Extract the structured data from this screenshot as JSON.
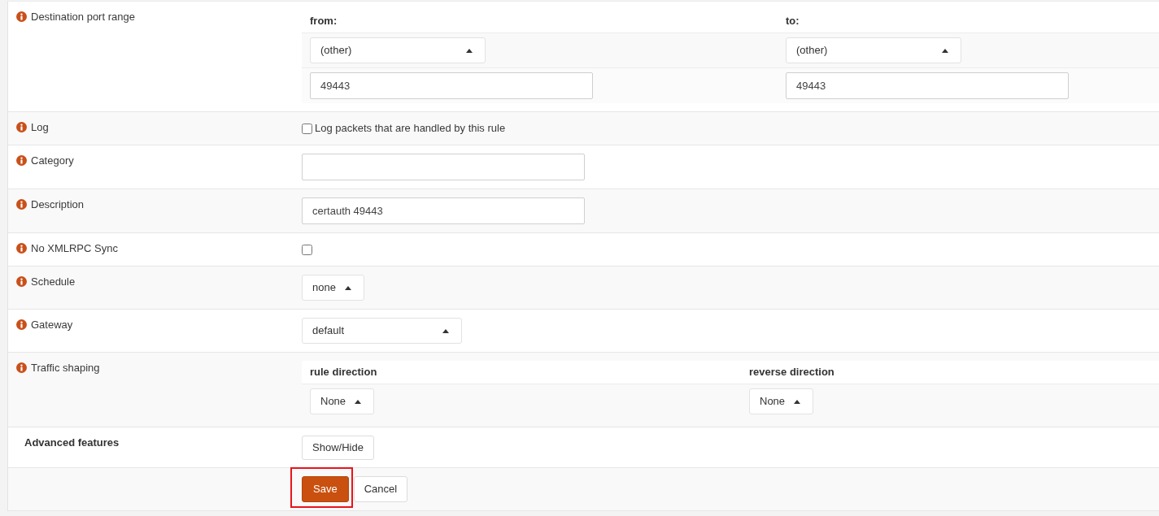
{
  "rows": [
    {
      "kind": "range",
      "label": "Destination port range",
      "info": true,
      "columns": [
        {
          "heading": "from:",
          "select": "(other)",
          "value": "49443"
        },
        {
          "heading": "to:",
          "select": "(other)",
          "value": "49443"
        }
      ]
    },
    {
      "kind": "checkbox",
      "label": "Log",
      "info": true,
      "checked": false,
      "text": "Log packets that are handled by this rule"
    },
    {
      "kind": "input",
      "label": "Category",
      "info": true
    },
    {
      "kind": "input",
      "label": "Description",
      "info": true,
      "value": "certauth 49443"
    },
    {
      "kind": "checkbox",
      "label": "No XMLRPC Sync",
      "info": true,
      "checked": false
    },
    {
      "kind": "picker",
      "label": "Schedule",
      "info": true,
      "select": "none"
    },
    {
      "kind": "select",
      "label": "Gateway",
      "info": true,
      "select": "default"
    },
    {
      "kind": "shaping",
      "label": "Traffic shaping",
      "info": true,
      "columns": [
        {
          "heading": "rule direction",
          "select": "None"
        },
        {
          "heading": "reverse direction",
          "select": "None"
        }
      ]
    },
    {
      "kind": "button",
      "label": "Advanced features",
      "info": false,
      "button": "Show/Hide"
    },
    {
      "kind": "actions",
      "buttons": [
        {
          "label": "Save",
          "primary": true,
          "highlighted": true
        },
        {
          "label": "Cancel",
          "primary": false,
          "highlighted": false
        }
      ]
    }
  ]
}
